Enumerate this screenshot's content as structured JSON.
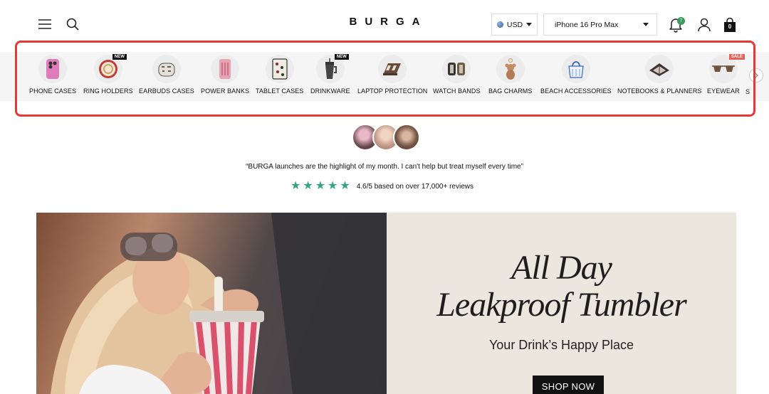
{
  "header": {
    "logo": "BURGA",
    "currency": "USD",
    "device_select": "iPhone 16 Pro Max",
    "notification_count": "7",
    "cart_count": "0"
  },
  "categories": [
    {
      "label": "PHONE CASES",
      "icon": "phone-case-icon"
    },
    {
      "label": "RING HOLDERS",
      "icon": "ring-holder-icon",
      "tag": "NEW"
    },
    {
      "label": "EARBUDS CASES",
      "icon": "earbuds-case-icon"
    },
    {
      "label": "POWER BANKS",
      "icon": "power-bank-icon"
    },
    {
      "label": "TABLET CASES",
      "icon": "tablet-case-icon"
    },
    {
      "label": "DRINKWARE",
      "icon": "tumbler-icon",
      "tag": "NEW"
    },
    {
      "label": "LAPTOP PROTECTION",
      "icon": "laptop-sleeve-icon"
    },
    {
      "label": "WATCH BANDS",
      "icon": "watch-band-icon"
    },
    {
      "label": "BAG CHARMS",
      "icon": "teddy-bear-charm-icon"
    },
    {
      "label": "BEACH ACCESSORIES",
      "icon": "beach-bag-icon"
    },
    {
      "label": "NOTEBOOKS & PLANNERS",
      "icon": "notebook-icon"
    },
    {
      "label": "EYEWEAR",
      "icon": "sunglasses-icon",
      "tag": "SALE"
    },
    {
      "label": "S"
    }
  ],
  "reviews": {
    "quote": "“BURGA launches are the highlight of my month. I can't help but treat myself every time”",
    "rating_text": "4.6/5 based on over 17,000+ reviews",
    "stars": 5
  },
  "hero": {
    "title_line1": "All Day",
    "title_line2": "Leakproof Tumbler",
    "subtitle": "Your Drink’s Happy Place",
    "cta": "SHOP NOW"
  },
  "colors": {
    "highlight_border": "#e53935",
    "star": "#34a57a",
    "notification_badge": "#3a9c5a",
    "sale_tag": "#e4615a",
    "hero_panel": "#ece7de"
  }
}
